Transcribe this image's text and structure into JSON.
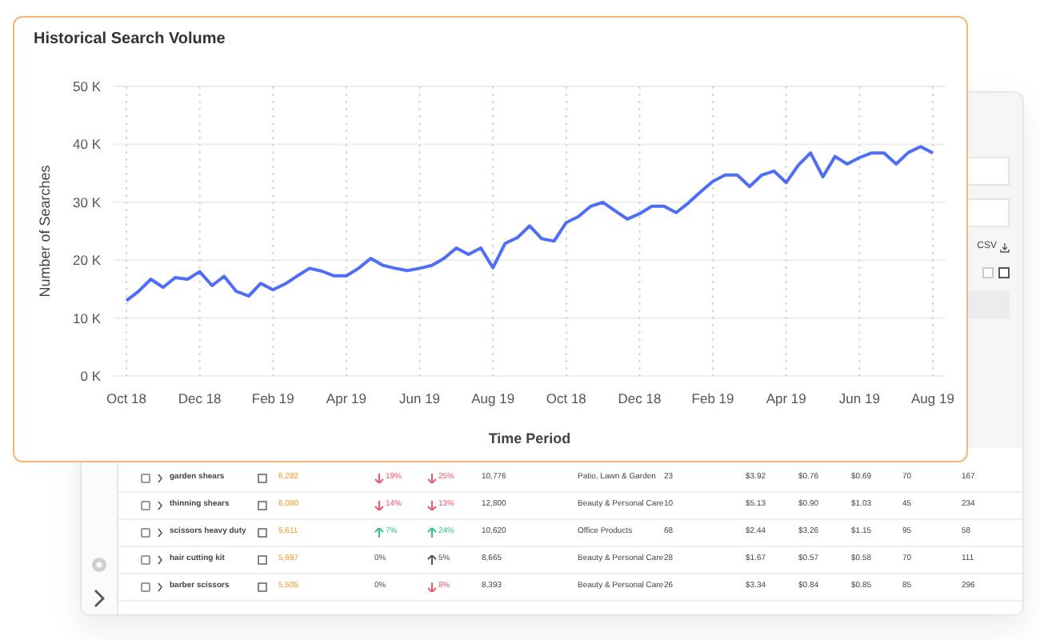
{
  "chart_card": {
    "title": "Historical Search Volume",
    "chart_data": {
      "type": "line",
      "xlabel": "Time Period",
      "ylabel": "Number of Searches",
      "ylim": [
        0,
        50000
      ],
      "yticks": [
        {
          "value": 0,
          "label": "0 K"
        },
        {
          "value": 10000,
          "label": "10 K"
        },
        {
          "value": 20000,
          "label": "20  K"
        },
        {
          "value": 30000,
          "label": "30 K"
        },
        {
          "value": 40000,
          "label": "40 K"
        },
        {
          "value": 50000,
          "label": "50 K"
        }
      ],
      "grid": true,
      "categories": [
        "Oct 18",
        null,
        null,
        null,
        null,
        null,
        "Dec 18",
        null,
        null,
        null,
        null,
        null,
        "Feb 19",
        null,
        null,
        null,
        null,
        null,
        "Apr 19",
        null,
        null,
        null,
        null,
        null,
        "Jun 19",
        null,
        null,
        null,
        null,
        null,
        "Aug 19",
        null,
        null,
        null,
        null,
        null,
        "Oct 18",
        null,
        null,
        null,
        null,
        null,
        "Dec 18",
        null,
        null,
        null,
        null,
        null,
        "Feb 19",
        null,
        null,
        null,
        null,
        null,
        "Apr 19",
        null,
        null,
        null,
        null,
        null,
        "Jun 19",
        null,
        null,
        null,
        null,
        null,
        "Aug 19"
      ],
      "series": [
        {
          "color": "#4f6ef7",
          "values": [
            13000,
            14600,
            16700,
            15300,
            17000,
            16700,
            18000,
            15600,
            17200,
            14600,
            13800,
            16000,
            14900,
            15900,
            17300,
            18600,
            18100,
            17300,
            17300,
            18600,
            20300,
            19100,
            18600,
            18200,
            18600,
            19100,
            20300,
            22100,
            21000,
            22100,
            18700,
            22900,
            23900,
            25900,
            23700,
            23300,
            26500,
            27500,
            29300,
            30000,
            28500,
            27100,
            28000,
            29300,
            29300,
            28200,
            29900,
            31800,
            33600,
            34700,
            34700,
            32700,
            34700,
            35400,
            33400,
            36400,
            38500,
            34400,
            37900,
            36600,
            37700,
            38500,
            38500,
            36600,
            38600,
            39600,
            38500
          ]
        }
      ]
    }
  },
  "table": {
    "download_label": "CSV",
    "rows": [
      {
        "checked": false,
        "keyword": "garden shears",
        "volume": "6,282",
        "change_1": {
          "text": "19%",
          "kind": "down"
        },
        "change_2": {
          "text": "25%",
          "kind": "down"
        },
        "column_5": "10,776",
        "category": "Patio, Lawn & Garden",
        "column_7": "23",
        "price_1": "$3.92",
        "price_2": "$0.76",
        "price_3": "$0.69",
        "column_11": "70",
        "column_12": "167"
      },
      {
        "checked": false,
        "keyword": "thinning shears",
        "volume": "6,080",
        "change_1": {
          "text": "14%",
          "kind": "down"
        },
        "change_2": {
          "text": "13%",
          "kind": "down"
        },
        "column_5": "12,800",
        "category": "Beauty & Personal Care",
        "column_7": "10",
        "price_1": "$5.13",
        "price_2": "$0.90",
        "price_3": "$1.03",
        "column_11": "45",
        "column_12": "234"
      },
      {
        "checked": false,
        "keyword": "scissors heavy duty",
        "volume": "5,611",
        "change_1": {
          "text": "7%",
          "kind": "up"
        },
        "change_2": {
          "text": "24%",
          "kind": "up"
        },
        "column_5": "10,620",
        "category": "Office Products",
        "column_7": "68",
        "price_1": "$2.44",
        "price_2": "$3.26",
        "price_3": "$1.15",
        "column_11": "95",
        "column_12": "58"
      },
      {
        "checked": false,
        "keyword": "hair cutting kit",
        "volume": "5,697",
        "change_1": {
          "text": "0%",
          "kind": "flat"
        },
        "change_2": {
          "text": "5%",
          "kind": "up_neutral"
        },
        "column_5": "8,665",
        "category": "Beauty & Personal Care",
        "column_7": "28",
        "price_1": "$1.67",
        "price_2": "$0.57",
        "price_3": "$0.58",
        "column_11": "70",
        "column_12": "111"
      },
      {
        "checked": false,
        "keyword": "barber scissors",
        "volume": "5,505",
        "change_1": {
          "text": "0%",
          "kind": "flat"
        },
        "change_2": {
          "text": "8%",
          "kind": "down"
        },
        "column_5": "8,393",
        "category": "Beauty & Personal Care",
        "column_7": "26",
        "price_1": "$3.34",
        "price_2": "$0.84",
        "price_3": "$0.85",
        "column_11": "85",
        "column_12": "296"
      }
    ]
  }
}
